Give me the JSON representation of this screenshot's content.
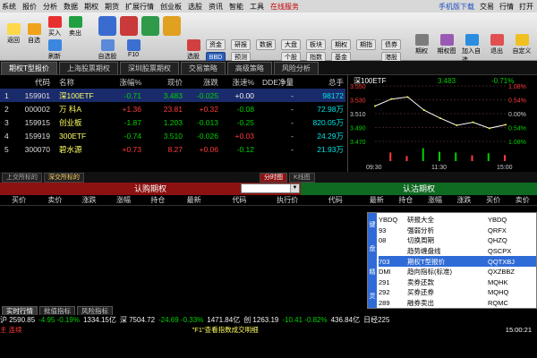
{
  "menu": {
    "items": [
      "系统",
      "报价",
      "分析",
      "数据",
      "期权",
      "期货",
      "扩展行情",
      "创业板",
      "选股",
      "资讯",
      "智能",
      "工具"
    ],
    "highlight": "在线服务",
    "right": [
      "手机版下载",
      "交易",
      "行情",
      "打开"
    ]
  },
  "toolbar": {
    "left_buttons": [
      "返回",
      "自选",
      "买入",
      "卖出",
      "刷新",
      "自选股",
      "F10",
      "选股"
    ],
    "pills": [
      "资金",
      "研报",
      "数据",
      "大盘",
      "板块",
      "期权",
      "期指",
      "BBD",
      "预测",
      "个股",
      "指数",
      "基金",
      "债券",
      "港股"
    ],
    "right_buttons": [
      "期权",
      "期权图",
      "加入自选",
      "退出",
      "自定义"
    ]
  },
  "tabs_top": [
    "期权T型报价",
    "上海股票期权",
    "深圳股票期权",
    "交易策略",
    "高级策略",
    "风险分析"
  ],
  "grid": {
    "headers": [
      "",
      "代码",
      "名称",
      "涨幅%",
      "现价",
      "涨跌",
      "涨速%",
      "DDE净量",
      "总手"
    ],
    "rows": [
      {
        "i": "1",
        "code": "159901",
        "name": "深100ETF",
        "chg": "-0.71",
        "price": "3.483",
        "diff": "-0.025",
        "speed": "+0.00",
        "dde": "-",
        "hand": "98172"
      },
      {
        "i": "2",
        "code": "000002",
        "name": "万 科A",
        "chg": "+1.36",
        "price": "23.81",
        "diff": "+0.32",
        "speed": "-0.08",
        "dde": "-",
        "hand": "72.98万"
      },
      {
        "i": "3",
        "code": "159915",
        "name": "创业板",
        "chg": "-1.87",
        "price": "1.203",
        "diff": "-0.013",
        "speed": "-0.25",
        "dde": "-",
        "hand": "820.05万"
      },
      {
        "i": "4",
        "code": "159919",
        "name": "300ETF",
        "chg": "-0.74",
        "price": "3.510",
        "diff": "-0.026",
        "speed": "+0.03",
        "dde": "-",
        "hand": "24.29万"
      },
      {
        "i": "5",
        "code": "300070",
        "name": "碧水源",
        "chg": "+0.73",
        "price": "8.27",
        "diff": "+0.06",
        "speed": "-0.12",
        "dde": "-",
        "hand": "21.93万"
      }
    ]
  },
  "chart": {
    "name": "深100ETF",
    "price": "3.483",
    "chg": "-0.71%",
    "left_ticks": [
      "3.550",
      "3.530",
      "3.510",
      "3.490",
      "3.470"
    ],
    "right_ticks": [
      "1.08%",
      "0.54%",
      "0.00%",
      "0.54%",
      "1.08%"
    ],
    "x_ticks": [
      "09:30",
      "11:30",
      "15:00"
    ],
    "colors": {
      "line": "#ffffff",
      "avg": "#ffff00",
      "vol_up": "#ff3b3b",
      "vol_dn": "#00d000"
    }
  },
  "chart_data": {
    "type": "line",
    "title": "深100ETF",
    "x": [
      "09:30",
      "10:00",
      "10:30",
      "11:00",
      "11:30",
      "13:30",
      "14:00",
      "14:30",
      "15:00"
    ],
    "series": [
      {
        "values": [
          3.52,
          3.534,
          3.538,
          3.512,
          3.496,
          3.482,
          3.488,
          3.476,
          3.483
        ]
      }
    ],
    "ylim": [
      3.45,
      3.56
    ]
  },
  "tabs_mid": [
    "上交所标的",
    "深交所标的",
    "分时图",
    "K线图"
  ],
  "options": {
    "call_title": "认购期权",
    "put_title": "认沽期权",
    "call_cols": [
      "买价",
      "卖价",
      "涨跌",
      "涨幅",
      "持仓",
      "最新",
      "代码"
    ],
    "center_col": "执行价",
    "put_cols": [
      "代码",
      "最新",
      "持仓",
      "涨幅",
      "涨跌",
      "买价",
      "卖价"
    ]
  },
  "keyboard_wizard": {
    "side": [
      "键",
      "盘",
      "精",
      "灵"
    ],
    "items": [
      {
        "a": "YBDQ",
        "b": "研报大全",
        "c": "YBDQ"
      },
      {
        "a": "93",
        "b": "强弱分析",
        "c": "QRFX"
      },
      {
        "a": "08",
        "b": "切换周期",
        "c": "QHZQ"
      },
      {
        "a": "",
        "b": "趋势缠盘线",
        "c": "QSCPX"
      },
      {
        "a": "703",
        "b": "期权T型报价",
        "c": "QQTXBJ"
      },
      {
        "a": "DMI",
        "b": "趋向指标(标准)",
        "c": "QXZBBZ"
      },
      {
        "a": "291",
        "b": "卖券还款",
        "c": "MQHK"
      },
      {
        "a": "292",
        "b": "买券还券",
        "c": "MQHQ"
      },
      {
        "a": "289",
        "b": "融券卖出",
        "c": "RQMC"
      }
    ],
    "input_value": "0"
  },
  "tabs_bottom": [
    "实时行情",
    "批值指标",
    "风险指标"
  ],
  "ticker": [
    {
      "t": "沪 2590.85",
      "cls": "wh"
    },
    {
      "t": "-4.95 -0.19%",
      "cls": "dn"
    },
    {
      "t": "1334.15亿",
      "cls": "wh"
    },
    {
      "t": "深 7504.72",
      "cls": "wh"
    },
    {
      "t": "-24.69 -0.33%",
      "cls": "dn"
    },
    {
      "t": "1471.84亿",
      "cls": "wh"
    },
    {
      "t": "创 1263.19",
      "cls": "wh"
    },
    {
      "t": "-10.41 -0.82%",
      "cls": "dn"
    },
    {
      "t": "436.84亿",
      "cls": "wh"
    },
    {
      "t": "日经225",
      "cls": "wh"
    }
  ],
  "status": {
    "left": "主 连续",
    "hint": "\"F1\"查看指数成交明细",
    "clock": "15:00:21"
  }
}
